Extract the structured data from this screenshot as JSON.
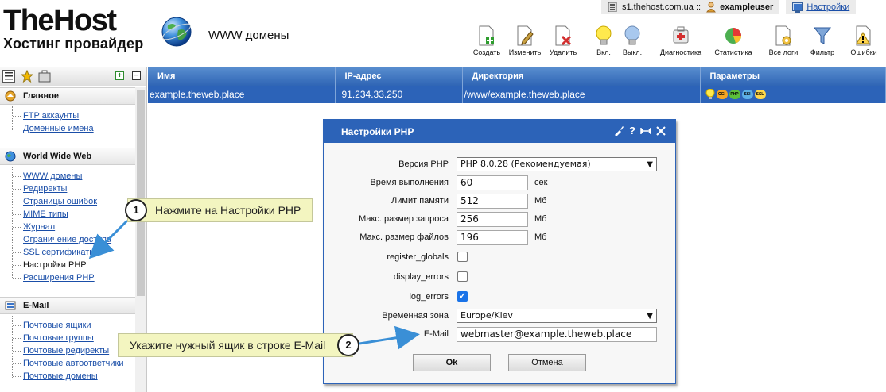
{
  "topbar": {
    "host": "s1.thehost.com.ua ::",
    "user": "exampleuser",
    "settings": "Настройки"
  },
  "brand": {
    "title": "TheHost",
    "subtitle": "Хостинг провайдер"
  },
  "page_title": "WWW домены",
  "toolbar": [
    {
      "id": "create",
      "label": "Создать"
    },
    {
      "id": "edit",
      "label": "Изменить"
    },
    {
      "id": "delete",
      "label": "Удалить"
    },
    {
      "id": "on",
      "label": "Вкл."
    },
    {
      "id": "off",
      "label": "Выкл."
    },
    {
      "id": "diag",
      "label": "Диагностика"
    },
    {
      "id": "stats",
      "label": "Статистика"
    },
    {
      "id": "logs",
      "label": "Все логи"
    },
    {
      "id": "filter",
      "label": "Фильтр"
    },
    {
      "id": "errors",
      "label": "Ошибки"
    }
  ],
  "sidebar": {
    "sections": [
      {
        "title": "Главное",
        "items": [
          "FTP аккаунты",
          "Доменные имена"
        ]
      },
      {
        "title": "World Wide Web",
        "items": [
          "WWW домены",
          "Редиректы",
          "Страницы ошибок",
          "MIME типы",
          "Журнал",
          "Ограничение доступа",
          "SSL сертификаты",
          "Настройки PHP",
          "Расширения PHP"
        ]
      },
      {
        "title": "E-Mail",
        "items": [
          "Почтовые ящики",
          "Почтовые группы",
          "Почтовые редиректы",
          "Почтовые автоответчики",
          "Почтовые домены"
        ]
      }
    ]
  },
  "table": {
    "columns": [
      "Имя",
      "IP-адрес",
      "Директория",
      "Параметры"
    ],
    "rows": [
      {
        "name": "example.theweb.place",
        "ip": "91.234.33.250",
        "dir": "/www/example.theweb.place",
        "params": [
          "bulb",
          "CGI",
          "PHP",
          "SSI",
          "SSL"
        ]
      }
    ]
  },
  "dialog": {
    "title": "Настройки PHP",
    "fields": {
      "php_version": {
        "label": "Версия PHP",
        "value": "PHP 8.0.28 (Рекомендуемая)"
      },
      "exec_time": {
        "label": "Время выполнения",
        "value": "60",
        "unit": "сек"
      },
      "memory_limit": {
        "label": "Лимит памяти",
        "value": "512",
        "unit": "Мб"
      },
      "post_max": {
        "label": "Макс. размер запроса",
        "value": "256",
        "unit": "Мб"
      },
      "upload_max": {
        "label": "Макс. размер файлов",
        "value": "196",
        "unit": "Мб"
      },
      "register_globals": {
        "label": "register_globals",
        "checked": false
      },
      "display_errors": {
        "label": "display_errors",
        "checked": false
      },
      "log_errors": {
        "label": "log_errors",
        "checked": true
      },
      "timezone": {
        "label": "Временная зона",
        "value": "Europe/Kiev"
      },
      "email": {
        "label": "E-Mail",
        "value": "webmaster@example.theweb.place"
      }
    },
    "ok": "Ok",
    "cancel": "Отмена"
  },
  "callouts": [
    {
      "number": "1",
      "text": "Нажмите на Настройки PHP"
    },
    {
      "number": "2",
      "text": "Укажите нужный ящик в строке E-Mail"
    }
  ],
  "colors": {
    "accent": "#2c63b8",
    "link": "#1a4ea8",
    "callout": "#f3f5c0",
    "arrow": "#3a8fd6"
  }
}
